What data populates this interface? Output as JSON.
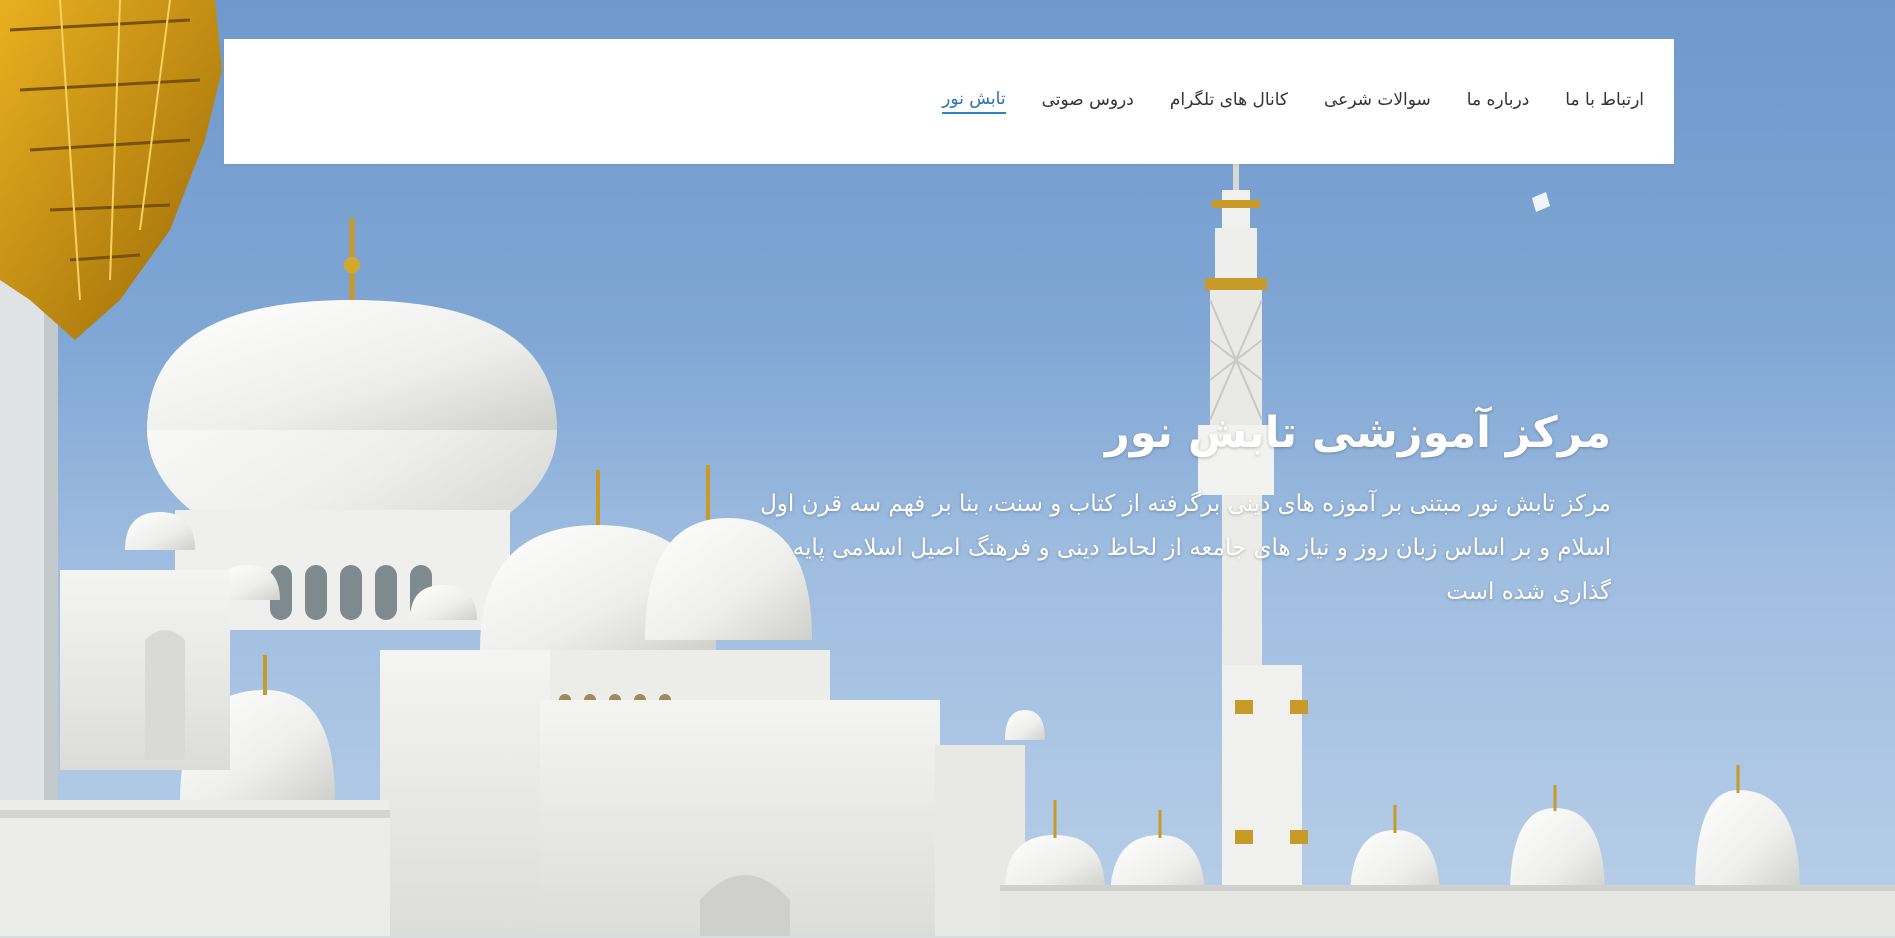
{
  "nav": {
    "items": [
      {
        "label": "تابش نور",
        "active": true
      },
      {
        "label": "دروس صوتی",
        "active": false
      },
      {
        "label": "کانال های تلگرام",
        "active": false
      },
      {
        "label": "سوالات شرعی",
        "active": false
      },
      {
        "label": "درباره ما",
        "active": false
      },
      {
        "label": "ارتباط با ما",
        "active": false
      }
    ]
  },
  "hero": {
    "title": "مرکز آموزشی تابش نور",
    "text": "مرکز تابش نور مبتنی بر آموزه های دینی برگرفته از کتاب و سنت، بنا بر فهم سه قرن اول اسلام و بر اساس زبان روز و نیاز های جامعه از لحاظ دینی و فرهنگ اصیل اسلامی پایه گذاری شده است",
    "background_image": "mosque-photo"
  },
  "colors": {
    "sky": "#7fa6d4",
    "accent": "#2a82c9",
    "navbar_bg": "#ffffff"
  }
}
